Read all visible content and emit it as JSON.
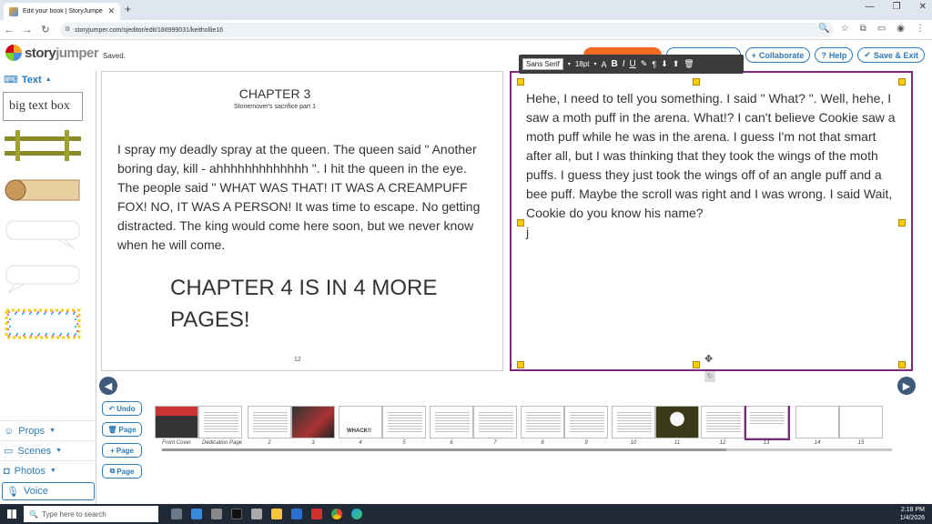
{
  "browser": {
    "tab_title": "Edit your book | StoryJumper",
    "url": "storyjumper.com/sjeditor/edit/186999031/keithollie16",
    "new_tab": "+"
  },
  "app": {
    "logo_text": "storyjumper",
    "logo_text_a": "story",
    "logo_text_b": "jumper",
    "saved_status": "Saved.",
    "collaborate": "Collaborate",
    "help": "Help",
    "save_exit": "Save & Exit"
  },
  "leftpanel": {
    "text_section": "Text",
    "big_text_box": "big text box",
    "props": "Props",
    "scenes": "Scenes",
    "photos": "Photos",
    "voice": "Voice"
  },
  "actions": {
    "undo": "Undo",
    "page1": "Page",
    "page2": "Page",
    "page3": "Page"
  },
  "toolbar": {
    "font": "Sans Serif",
    "size": "18pt"
  },
  "pages": {
    "left": {
      "chapter": "CHAPTER 3",
      "subtitle": "Stonemover's sacrifice part 1",
      "body": "I spray my deadly spray at the queen. The queen said \" Another boring day, kill - ahhhhhhhhhhhhh \".  I hit the queen in the eye. The people said \" WHAT WAS THAT! IT WAS A CREAMPUFF FOX! NO, IT WAS A PERSON!  It was time to escape. No getting distracted. The king would come here soon, but we never know when he will come.",
      "notice": "CHAPTER 4 IS IN 4 MORE PAGES!",
      "page_number": "12"
    },
    "right": {
      "body": "Hehe, I need to tell you something. I said \" What? \".  Well, hehe, I saw a moth puff in the arena. What!? I can't believe Cookie saw a moth puff while he was in the arena. I guess I'm not that smart after all, but I was thinking that they took the wings of the moth puffs. I guess they just took the wings off of an angle puff and a bee puff. Maybe the scroll was right and I was wrong. I said Wait, Cookie do you know his name?",
      "cursor_text": "j"
    }
  },
  "filmstrip": [
    {
      "label": "Front Cover"
    },
    {
      "label": "Dedication Page"
    },
    {
      "label": "2"
    },
    {
      "label": "3"
    },
    {
      "label": "4",
      "caption": "WHACK!!"
    },
    {
      "label": "5"
    },
    {
      "label": "6"
    },
    {
      "label": "7"
    },
    {
      "label": "8"
    },
    {
      "label": "9"
    },
    {
      "label": "10"
    },
    {
      "label": "11"
    },
    {
      "label": "12"
    },
    {
      "label": "13"
    },
    {
      "label": "14"
    },
    {
      "label": "15"
    }
  ],
  "taskbar": {
    "search_placeholder": "Type here to search",
    "time": "2:18 PM",
    "date": "1/4/2026"
  },
  "colors": {
    "accent": "#2a7ab8",
    "selection": "#7b2a7b",
    "handle": "#f7d000",
    "orange": "#f26c22"
  }
}
